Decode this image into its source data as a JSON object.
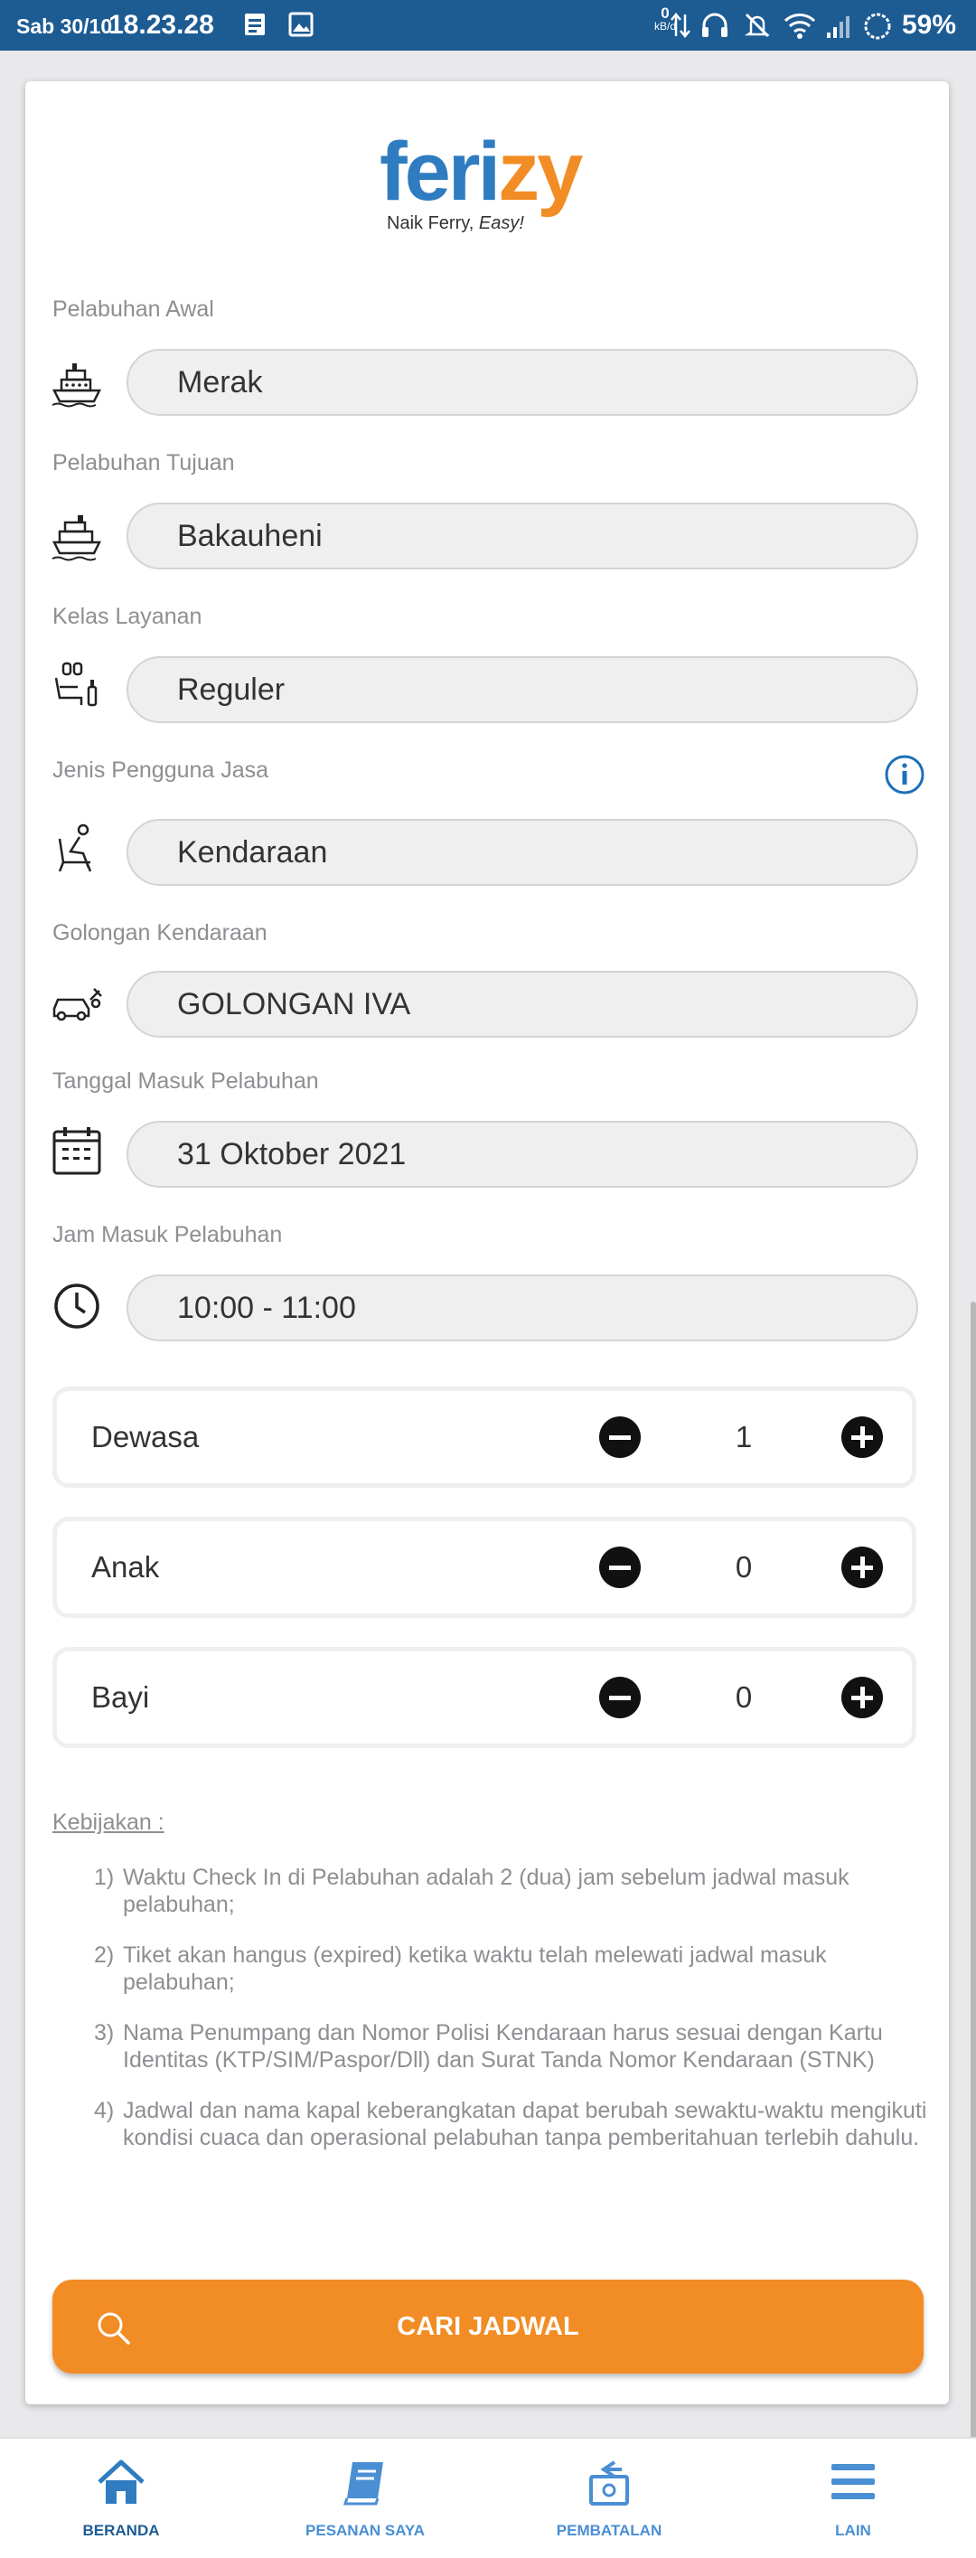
{
  "status_bar": {
    "day": "Sab 30/10",
    "time": "18.23.28",
    "net_speed_value": "0",
    "net_speed_unit": "kB/d",
    "battery": "59%"
  },
  "logo": {
    "word_blue": "feri",
    "word_orange": "zy",
    "tagline_prefix": "Naik Ferry, ",
    "tagline_emph": "Easy!"
  },
  "form": {
    "fields": [
      {
        "label": "Pelabuhan Awal",
        "value": "Merak",
        "icon": "ship-icon"
      },
      {
        "label": "Pelabuhan Tujuan",
        "value": "Bakauheni",
        "icon": "ship-icon"
      },
      {
        "label": "Kelas Layanan",
        "value": "Reguler",
        "icon": "seat-class-icon"
      },
      {
        "label": "Jenis Pengguna Jasa",
        "value": "Kendaraan",
        "icon": "passenger-seat-icon"
      },
      {
        "label": "Golongan Kendaraan",
        "value": "GOLONGAN IVA",
        "icon": "vehicle-icon"
      },
      {
        "label": "Tanggal Masuk Pelabuhan",
        "value": "31 Oktober 2021",
        "icon": "calendar-icon"
      },
      {
        "label": "Jam Masuk Pelabuhan",
        "value": "10:00 - 11:00",
        "icon": "clock-icon"
      }
    ]
  },
  "passengers": [
    {
      "label": "Dewasa",
      "count": "1"
    },
    {
      "label": "Anak",
      "count": "0"
    },
    {
      "label": "Bayi",
      "count": "0"
    }
  ],
  "policy": {
    "title": "Kebijakan :",
    "items": [
      {
        "num": "1)",
        "text": "Waktu Check In di Pelabuhan adalah 2 (dua) jam sebelum jadwal masuk pelabuhan;"
      },
      {
        "num": "2)",
        "text": "Tiket akan hangus (expired) ketika waktu telah melewati jadwal masuk pelabuhan;"
      },
      {
        "num": "3)",
        "text": "Nama Penumpang dan Nomor Polisi Kendaraan harus sesuai dengan Kartu Identitas (KTP/SIM/Paspor/Dll) dan Surat Tanda Nomor Kendaraan (STNK)"
      },
      {
        "num": "4)",
        "text": "Jadwal dan nama kapal keberangkatan dapat berubah sewaktu-waktu mengikuti kondisi cuaca dan operasional pelabuhan tanpa pemberitahuan terlebih dahulu."
      }
    ]
  },
  "search_button": {
    "label": "CARI JADWAL"
  },
  "bottom_nav": [
    {
      "label": "BERANDA",
      "icon": "home-icon",
      "active": true
    },
    {
      "label": "PESANAN SAYA",
      "icon": "book-icon",
      "active": false
    },
    {
      "label": "PEMBATALAN",
      "icon": "refund-icon",
      "active": false
    },
    {
      "label": "LAIN",
      "icon": "menu-icon",
      "active": false
    }
  ],
  "colors": {
    "primary": "#1d5b93",
    "accent": "#f28c24",
    "logo_blue": "#2f7cc0"
  }
}
